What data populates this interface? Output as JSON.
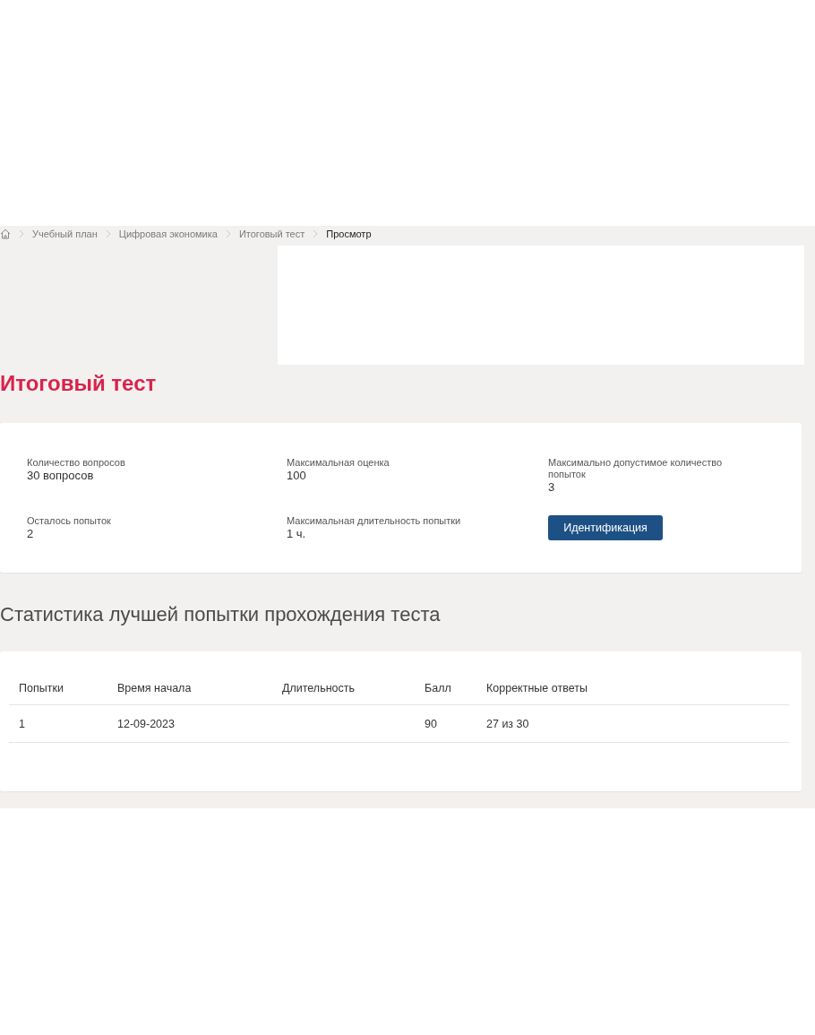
{
  "breadcrumb": [
    {
      "label": "Учебный план",
      "current": false
    },
    {
      "label": "Цифровая экономика",
      "current": false
    },
    {
      "label": "Итоговый тест",
      "current": false
    },
    {
      "label": "Просмотр",
      "current": true
    }
  ],
  "title": "Итоговый тест",
  "info": {
    "fields": [
      {
        "label": "Количество вопросов",
        "value": "30 вопросов"
      },
      {
        "label": "Максимальная оценка",
        "value": "100"
      },
      {
        "label": "Максимально допустимое количество попыток",
        "value": "3"
      },
      {
        "label": "Осталось попыток",
        "value": "2"
      },
      {
        "label": "Максимальная длительность попытки",
        "value": "1 ч."
      }
    ],
    "button": "Идентификация"
  },
  "stats": {
    "heading": "Статистика лучшей попытки прохождения теста",
    "columns": [
      "Попытки",
      "Время начала",
      "Длительность",
      "Балл",
      "Корректные ответы"
    ],
    "rows": [
      [
        "1",
        "12-09-2023",
        null,
        "90",
        "27 из 30"
      ]
    ]
  }
}
